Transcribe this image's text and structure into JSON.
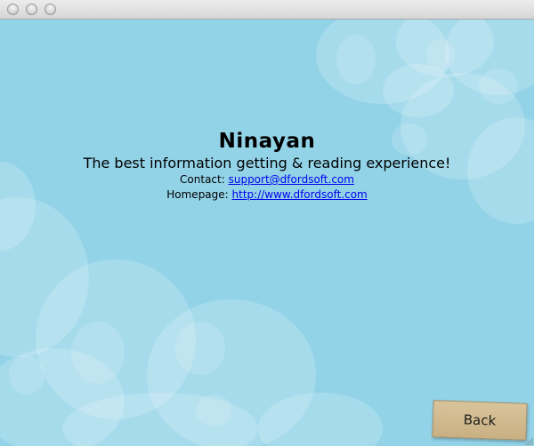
{
  "app": {
    "name": "Ninayan",
    "tagline": "The best information getting & reading experience!"
  },
  "contact": {
    "label": "Contact:",
    "value": "support@dfordsoft.com"
  },
  "homepage": {
    "label": "Homepage:",
    "value": "http://www.dfordsoft.com"
  },
  "back_button": {
    "label": "Back"
  },
  "colors": {
    "background": "#93d3e8",
    "cloud": "#bfe5f2",
    "link": "#0000ee",
    "button": "#cfb88b"
  }
}
